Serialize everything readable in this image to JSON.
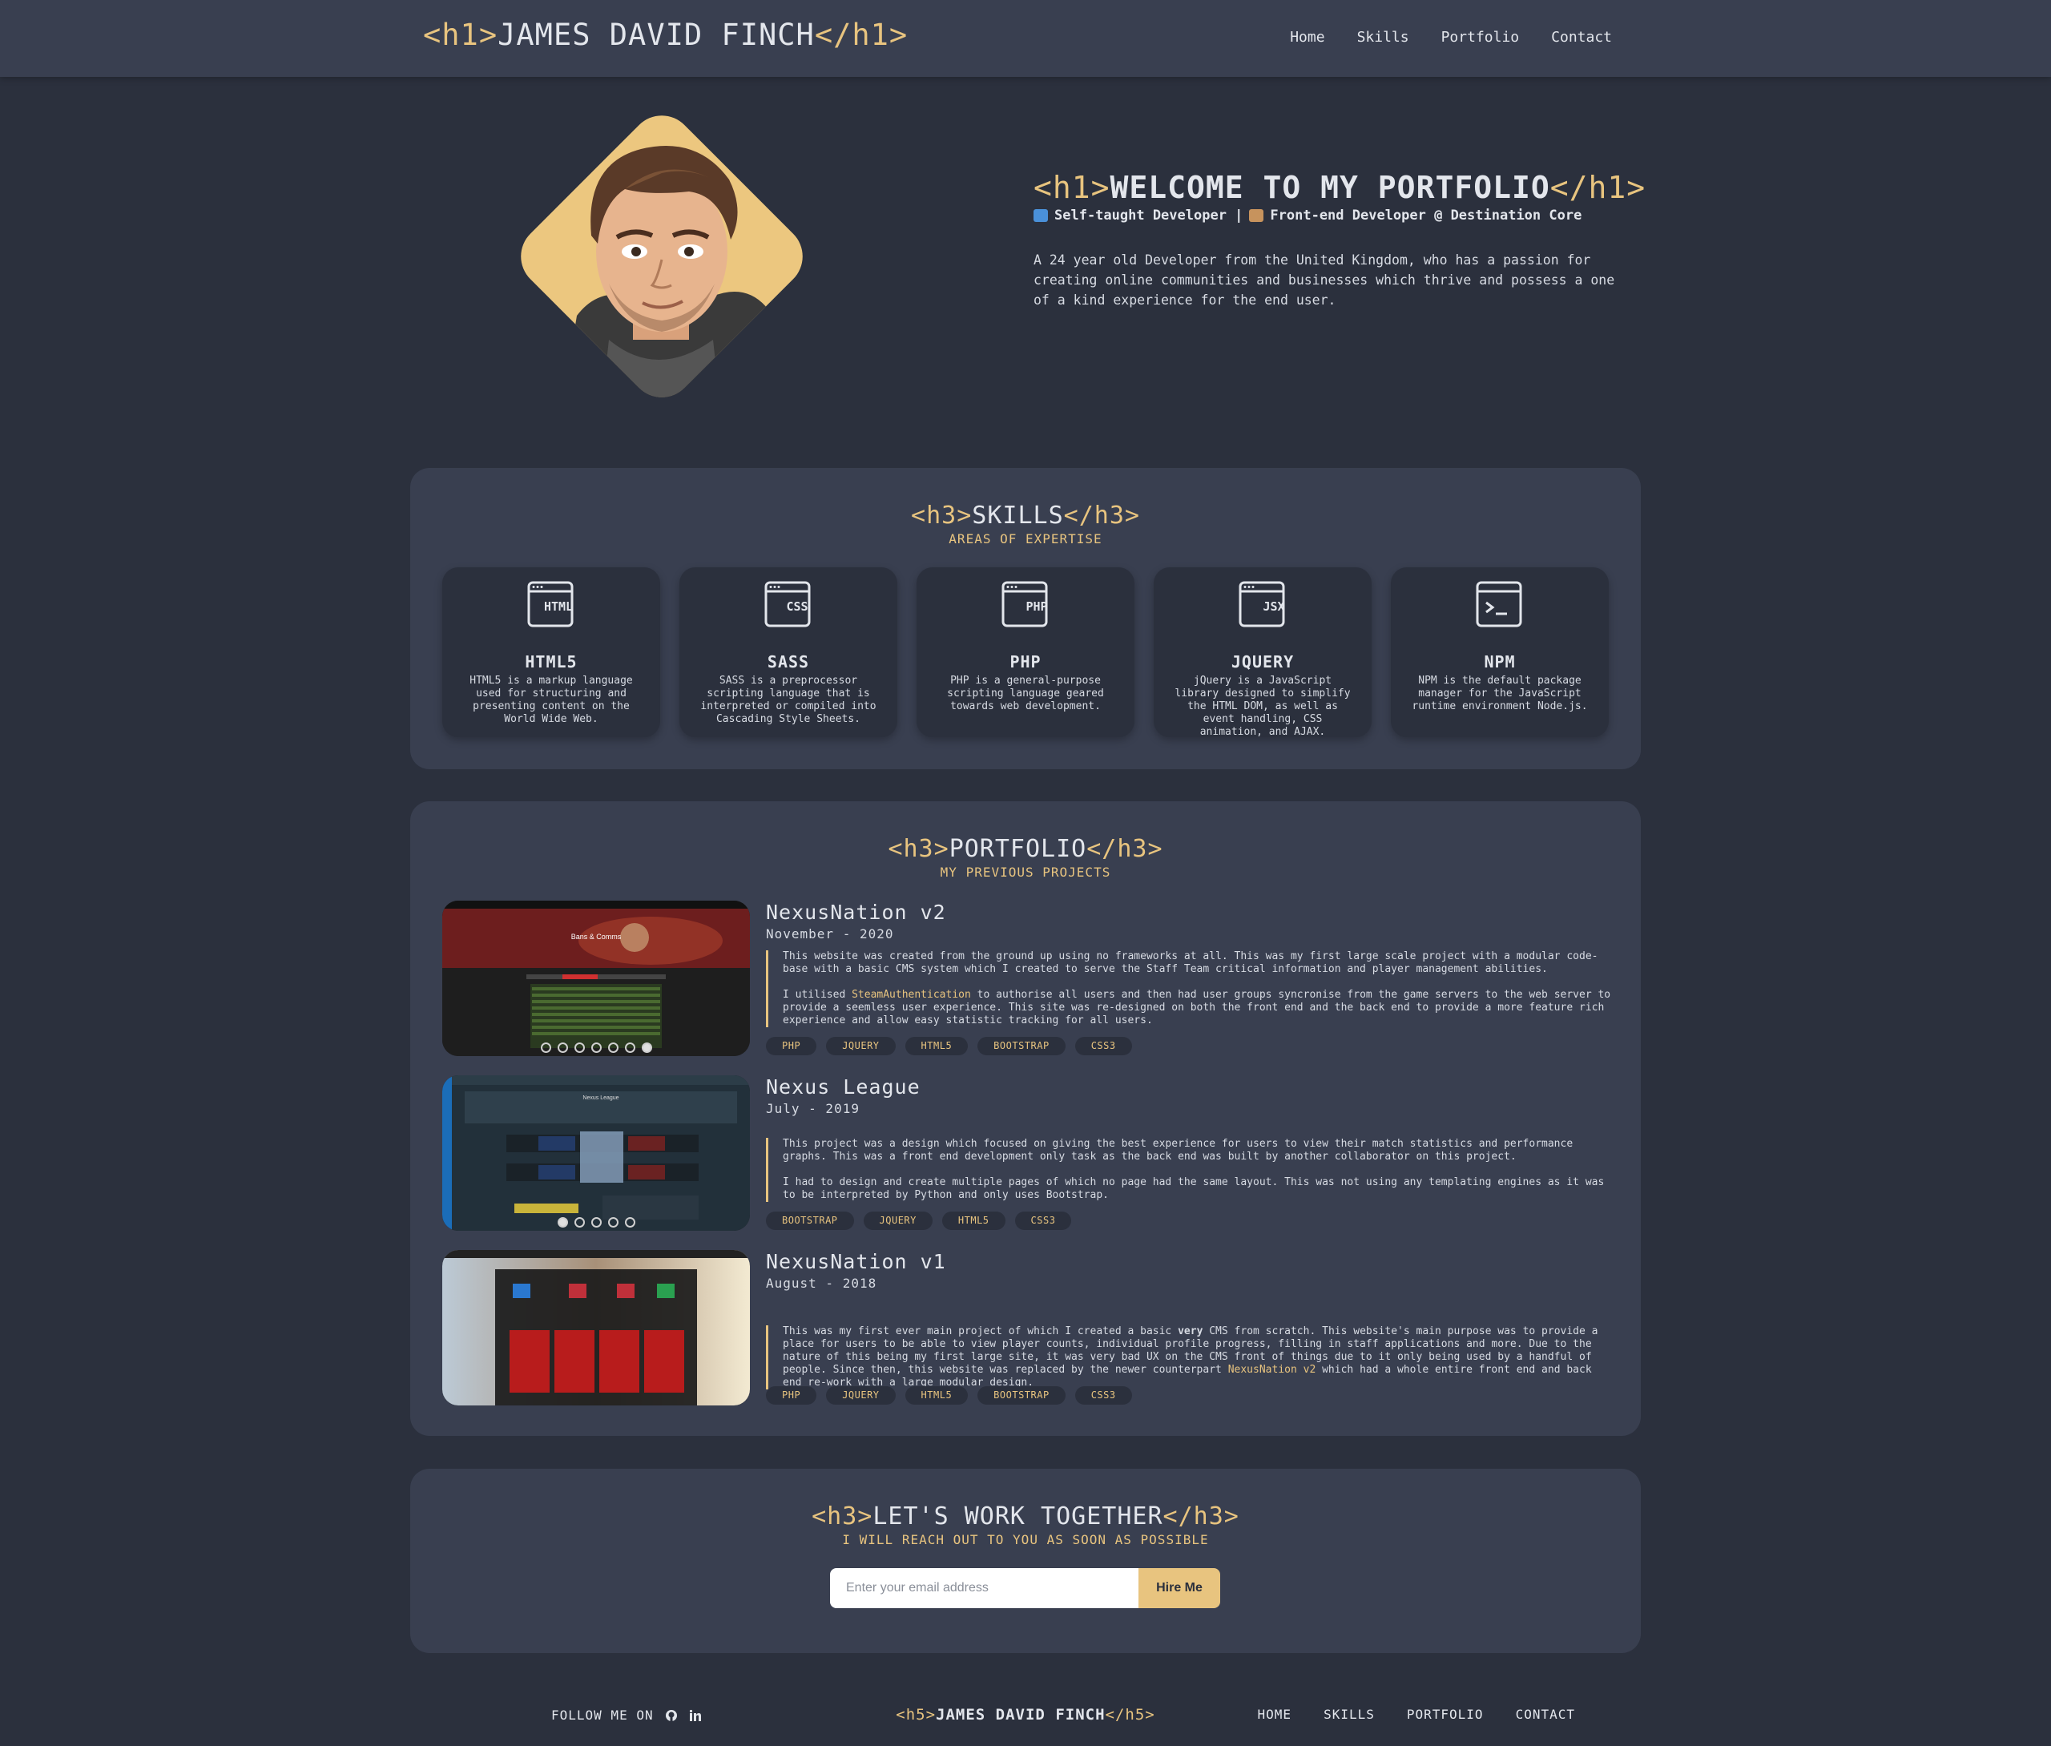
{
  "nav": {
    "brand_open": "<h1>",
    "brand_name": "JAMES DAVID FINCH",
    "brand_close": "</h1>",
    "links": [
      "Home",
      "Skills",
      "Portfolio",
      "Contact"
    ]
  },
  "hero": {
    "title_open": "<h1>",
    "title": "WELCOME TO MY PORTFOLIO",
    "title_close": "</h1>",
    "subtitle": "Self-taught Developer |   Front-end Developer @ Destination Core",
    "subtitle_a": "Self-taught Developer |",
    "subtitle_b": "Front-end Developer @ Destination Core",
    "description": "A 24 year old Developer from the United Kingdom, who has a passion for creating online communities and businesses which thrive and possess a one of a kind experience for the end user."
  },
  "skills": {
    "heading_open": "<h3>",
    "heading": "SKILLS",
    "heading_close": "</h3>",
    "subheading": "AREAS OF EXPERTISE",
    "items": [
      {
        "icon": "HTML",
        "name": "HTML5",
        "desc": "HTML5 is a markup language used for structuring and presenting content on the World Wide Web."
      },
      {
        "icon": "CSS",
        "name": "SASS",
        "desc": "SASS is a preprocessor scripting language that is interpreted or compiled into Cascading Style Sheets."
      },
      {
        "icon": "PHP",
        "name": "PHP",
        "desc": "PHP is a general-purpose scripting language geared towards web development."
      },
      {
        "icon": "JSX",
        "name": "JQUERY",
        "desc": "jQuery is a JavaScript library designed to simplify the HTML DOM, as well as event handling, CSS animation, and AJAX."
      },
      {
        "icon": ">_",
        "name": "NPM",
        "desc": "NPM is the default package manager for the JavaScript runtime environment Node.js."
      }
    ]
  },
  "portfolio": {
    "heading_open": "<h3>",
    "heading": "PORTFOLIO",
    "heading_close": "</h3>",
    "subheading": "MY PREVIOUS PROJECTS",
    "projects": [
      {
        "title": "NexusNation v2",
        "date": "November - 2020",
        "p1": "This website was created from the ground up using no frameworks at all. This was my first large scale project with a modular code-base with a basic CMS system which I created to serve the Staff Team critical information and player management abilities.",
        "p2_pre": "I utilised ",
        "p2_link": "SteamAuthentication",
        "p2_post": " to authorise all users and then had user groups syncronise from the game servers to the web server to provide a seemless user experience. This site was re-designed on both the front end and the back end to provide a more feature rich experience and allow easy statistic tracking for all users.",
        "tags": [
          "PHP",
          "JQUERY",
          "HTML5",
          "BOOTSTRAP",
          "CSS3"
        ],
        "shot_caption": "Bans & Comms"
      },
      {
        "title": "Nexus League",
        "date": "July - 2019",
        "p1": "This project was a design which focused on giving the best experience for users to view their match statistics and performance graphs. This was a front end development only task as the back end was built by another collaborator on this project.",
        "p2": "I had to design and create multiple pages of which no page had the same layout. This was not using any templating engines as it was to be interpreted by Python and only uses Bootstrap.",
        "tags": [
          "BOOTSTRAP",
          "JQUERY",
          "HTML5",
          "CSS3"
        ],
        "shot_caption": "Nexus League"
      },
      {
        "title": "NexusNation v1",
        "date": "August - 2018",
        "p1_pre": "This was my first ever main project of which I created a basic ",
        "p1_bold": "very",
        "p1_mid": " CMS from scratch. This website's main purpose was to provide a place for users to be able to view player counts, individual profile progress, filling in staff applications and more. Due to the nature of this being my first large site, it was very bad UX on the CMS front of things due to it only being used by a handful of people. Since then, this website was replaced by the newer counterpart ",
        "p1_link": "NexusNation v2",
        "p1_post": " which had a whole entire front end and back end re-work with a large modular design.",
        "tags": [
          "PHP",
          "JQUERY",
          "HTML5",
          "BOOTSTRAP",
          "CSS3"
        ]
      }
    ]
  },
  "contact": {
    "heading_open": "<h3>",
    "heading": "LET'S WORK TOGETHER",
    "heading_close": "</h3>",
    "subheading": "I WILL REACH OUT TO YOU AS SOON AS POSSIBLE",
    "email_placeholder": "Enter your email address",
    "email_value": "",
    "button": "Hire Me"
  },
  "footer": {
    "follow": "FOLLOW ME ON",
    "brand_open": "<h5>",
    "brand_name": "JAMES DAVID FINCH",
    "brand_close": "</h5>",
    "links": [
      "HOME",
      "SKILLS",
      "PORTFOLIO",
      "CONTACT"
    ]
  },
  "colors": {
    "background": "#2b303d",
    "panel": "#393f50",
    "accent": "#e8c47f",
    "text": "#e3e6ec"
  },
  "icons": [
    "avatar-illustration",
    "html-window-icon",
    "css-window-icon",
    "php-window-icon",
    "jsx-window-icon",
    "terminal-window-icon",
    "github-icon",
    "linkedin-icon"
  ]
}
